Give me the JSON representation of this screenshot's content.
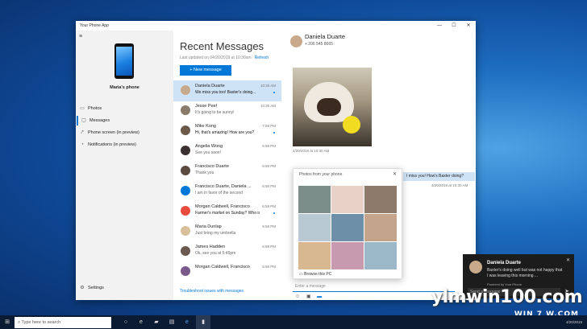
{
  "window": {
    "title": "Your Phone App",
    "min": "—",
    "max": "☐",
    "close": "✕"
  },
  "sidebar": {
    "phone_name": "Maria's phone",
    "items": [
      {
        "label": "Photos",
        "icon": "photo-icon"
      },
      {
        "label": "Messages",
        "icon": "message-icon"
      },
      {
        "label": "Phone screen (in preview)",
        "icon": "phone-screen-icon"
      },
      {
        "label": "Notifications (in preview)",
        "icon": "bell-icon"
      }
    ],
    "settings": "Settings"
  },
  "messages": {
    "title": "Recent Messages",
    "updated": "Last updated on 04/20/2019 at 10:30am",
    "refresh": "Refresh",
    "new_message": "+ New message",
    "troubleshoot": "Troubleshoot issues with messages",
    "list": [
      {
        "name": "Daniela Duarte",
        "msg": "We miss you too! Baxter's doing...",
        "time": "10:30 AM",
        "unread": true,
        "color": "#c9a98b"
      },
      {
        "name": "Jesse Peel",
        "msg": "It's going to be sunny!",
        "time": "10:30 AM",
        "unread": false,
        "color": "#8a7a6a"
      },
      {
        "name": "Mike Kong",
        "msg": "Hi, that's amazing! How are you?",
        "time": "7:59 PM",
        "unread": true,
        "color": "#6b5a4a"
      },
      {
        "name": "Angelia Wong",
        "msg": "See you soon!",
        "time": "6:58 PM",
        "unread": false,
        "color": "#3a3030"
      },
      {
        "name": "Francisco Duarte",
        "msg": "Thank you",
        "time": "6:58 PM",
        "unread": false,
        "color": "#5a4a40"
      },
      {
        "name": "Francisco Duarte, Daniela ...",
        "msg": "I am in favor of the second",
        "time": "6:58 PM",
        "unread": false,
        "color": "#0078d7"
      },
      {
        "name": "Morgan Caldwell, Francisco ...",
        "msg": "Farmer's market on Sunday? Who is...",
        "time": "6:58 PM",
        "unread": true,
        "color": "#e74c3c"
      },
      {
        "name": "Maria Dunlap",
        "msg": "Just bring my umbrella",
        "time": "6:58 PM",
        "unread": false,
        "color": "#d8c09a"
      },
      {
        "name": "James Hadden",
        "msg": "Ok, see you at 5:45pm",
        "time": "6:58 PM",
        "unread": false,
        "color": "#6a5a50"
      },
      {
        "name": "Morgan Caldwell, Francisco ...",
        "msg": "",
        "time": "6:58 PM",
        "unread": false,
        "color": "#7a5a8a"
      }
    ]
  },
  "conversation": {
    "name": "Daniela Duarte",
    "phone": "+ 206 545 8665",
    "photo_time": "4/20/2019 at 10:30 AM",
    "reply": "I miss you! How's Baxter doing?",
    "reply_time": "4/20/2019 at 10:30 AM",
    "picker_title": "Photos from your phone",
    "browse": "Browse this PC",
    "input_placeholder": "Enter a message",
    "photo_colors": [
      "#7b8e8a",
      "#e8d2c8",
      "#8d7a6a",
      "#b8c9d4",
      "#6e8fa8",
      "#c4a48a",
      "#d8b890",
      "#c89ab0",
      "#9ab8c8"
    ]
  },
  "toast": {
    "name": "Daniela Duarte",
    "msg": "Baxter's doing well but was not happy that I was leaving this morning ...",
    "powered": "Powered by Your Phone",
    "reply_placeholder": "Send a message"
  },
  "taskbar": {
    "search": "Type here to search",
    "date": "4/20/2019"
  },
  "watermark": {
    "main": "ylmwin100.com",
    "sub": "WIN 7 W.COM"
  }
}
